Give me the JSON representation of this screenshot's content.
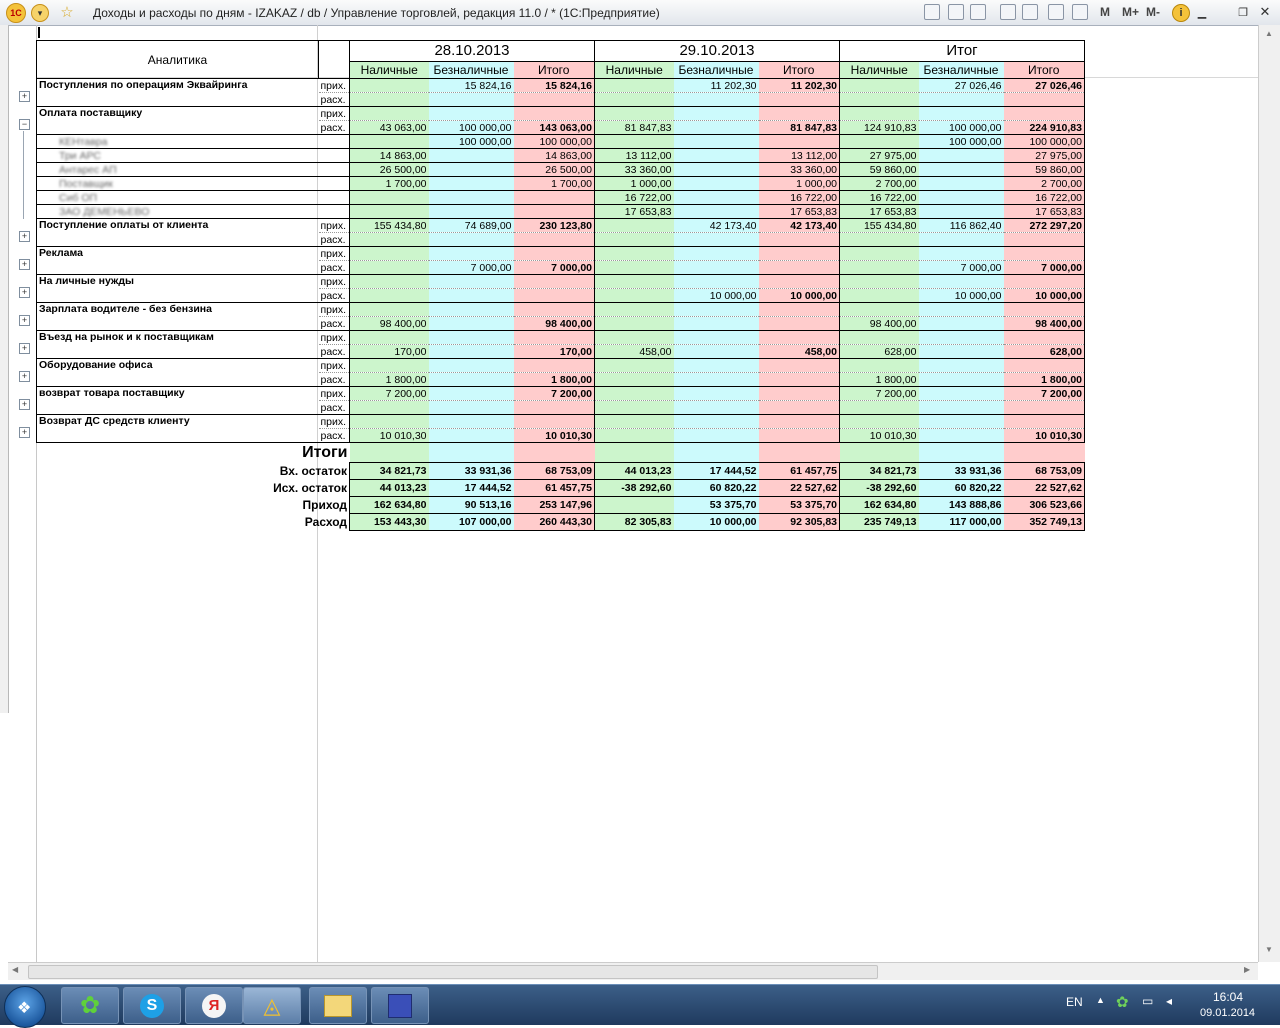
{
  "window": {
    "title": "Доходы и расходы по дням - IZAKAZ / db /  Управление торговлей, редакция 11.0 / * (1С:Предприятие)",
    "toolbar": [
      "M",
      "M+",
      "M-"
    ]
  },
  "report": {
    "analytics_header": "Аналитика",
    "columns": [
      {
        "date": "28.10.2013",
        "sub": [
          "Наличные",
          "Безналичные",
          "Итого"
        ]
      },
      {
        "date": "29.10.2013",
        "sub": [
          "Наличные",
          "Безналичные",
          "Итого"
        ]
      },
      {
        "date": "Итог",
        "sub": [
          "Наличные",
          "Безналичные",
          "Итого"
        ]
      }
    ],
    "prih_label": "прих.",
    "rash_label": "расх.",
    "groups": [
      {
        "name": "Поступления по операциям Эквайринга",
        "expanded": false,
        "prih": [
          "",
          "15 824,16",
          "15 824,16",
          "",
          "11 202,30",
          "11 202,30",
          "",
          "27 026,46",
          "27 026,46"
        ],
        "rash": [
          "",
          "",
          "",
          "",
          "",
          "",
          "",
          "",
          ""
        ]
      },
      {
        "name": "Оплата поставщику",
        "expanded": true,
        "prih": [
          "",
          "",
          "",
          "",
          "",
          "",
          "",
          "",
          ""
        ],
        "rash": [
          "43 063,00",
          "100 000,00",
          "143 063,00",
          "81 847,83",
          "",
          "81 847,83",
          "124 910,83",
          "100 000,00",
          "224 910,83"
        ],
        "children": [
          {
            "name": "КЕНтавра",
            "values": [
              "",
              "100 000,00",
              "100 000,00",
              "",
              "",
              "",
              "",
              "100 000,00",
              "100 000,00"
            ]
          },
          {
            "name": "Три АРС",
            "values": [
              "14 863,00",
              "",
              "14 863,00",
              "13 112,00",
              "",
              "13 112,00",
              "27 975,00",
              "",
              "27 975,00"
            ]
          },
          {
            "name": "Антарес АП",
            "values": [
              "26 500,00",
              "",
              "26 500,00",
              "33 360,00",
              "",
              "33 360,00",
              "59 860,00",
              "",
              "59 860,00"
            ]
          },
          {
            "name": "Поставщик",
            "values": [
              "1 700,00",
              "",
              "1 700,00",
              "1 000,00",
              "",
              "1 000,00",
              "2 700,00",
              "",
              "2 700,00"
            ]
          },
          {
            "name": "Сиб ОП",
            "values": [
              "",
              "",
              "",
              "16 722,00",
              "",
              "16 722,00",
              "16 722,00",
              "",
              "16 722,00"
            ]
          },
          {
            "name": "ЗАО ДЕМЕНЬЕВО",
            "values": [
              "",
              "",
              "",
              "17 653,83",
              "",
              "17 653,83",
              "17 653,83",
              "",
              "17 653,83"
            ]
          }
        ]
      },
      {
        "name": "Поступление оплаты от клиента",
        "expanded": false,
        "prih": [
          "155 434,80",
          "74 689,00",
          "230 123,80",
          "",
          "42 173,40",
          "42 173,40",
          "155 434,80",
          "116 862,40",
          "272 297,20"
        ],
        "rash": [
          "",
          "",
          "",
          "",
          "",
          "",
          "",
          "",
          ""
        ]
      },
      {
        "name": "Реклама",
        "expanded": false,
        "prih": [
          "",
          "",
          "",
          "",
          "",
          "",
          "",
          "",
          ""
        ],
        "rash": [
          "",
          "7 000,00",
          "7 000,00",
          "",
          "",
          "",
          "",
          "7 000,00",
          "7 000,00"
        ]
      },
      {
        "name": "На личные нужды",
        "expanded": false,
        "prih": [
          "",
          "",
          "",
          "",
          "",
          "",
          "",
          "",
          ""
        ],
        "rash": [
          "",
          "",
          "",
          "",
          "10 000,00",
          "10 000,00",
          "",
          "10 000,00",
          "10 000,00"
        ]
      },
      {
        "name": "Зарплата водителе - без бензина",
        "expanded": false,
        "prih": [
          "",
          "",
          "",
          "",
          "",
          "",
          "",
          "",
          ""
        ],
        "rash": [
          "98 400,00",
          "",
          "98 400,00",
          "",
          "",
          "",
          "98 400,00",
          "",
          "98 400,00"
        ]
      },
      {
        "name": "Въезд на рынок и к поставщикам",
        "expanded": false,
        "prih": [
          "",
          "",
          "",
          "",
          "",
          "",
          "",
          "",
          ""
        ],
        "rash": [
          "170,00",
          "",
          "170,00",
          "458,00",
          "",
          "458,00",
          "628,00",
          "",
          "628,00"
        ]
      },
      {
        "name": "Оборудование офиса",
        "expanded": false,
        "prih": [
          "",
          "",
          "",
          "",
          "",
          "",
          "",
          "",
          ""
        ],
        "rash": [
          "1 800,00",
          "",
          "1 800,00",
          "",
          "",
          "",
          "1 800,00",
          "",
          "1 800,00"
        ]
      },
      {
        "name": "возврат товара поставщику",
        "expanded": false,
        "prih": [
          "7 200,00",
          "",
          "7 200,00",
          "",
          "",
          "",
          "7 200,00",
          "",
          "7 200,00"
        ],
        "rash": [
          "",
          "",
          "",
          "",
          "",
          "",
          "",
          "",
          ""
        ]
      },
      {
        "name": "Возврат ДС средств клиенту",
        "expanded": false,
        "prih": [
          "",
          "",
          "",
          "",
          "",
          "",
          "",
          "",
          ""
        ],
        "rash": [
          "10 010,30",
          "",
          "10 010,30",
          "",
          "",
          "",
          "10 010,30",
          "",
          "10 010,30"
        ]
      }
    ],
    "totals": {
      "title": "Итоги",
      "rows": [
        {
          "label": "Вх. остаток",
          "values": [
            "34 821,73",
            "33 931,36",
            "68 753,09",
            "44 013,23",
            "17 444,52",
            "61 457,75",
            "34 821,73",
            "33 931,36",
            "68 753,09"
          ]
        },
        {
          "label": "Исх. остаток",
          "values": [
            "44 013,23",
            "17 444,52",
            "61 457,75",
            "-38 292,60",
            "60 820,22",
            "22 527,62",
            "-38 292,60",
            "60 820,22",
            "22 527,62"
          ]
        },
        {
          "label": "Приход",
          "values": [
            "162 634,80",
            "90 513,16",
            "253 147,96",
            "",
            "53 375,70",
            "53 375,70",
            "162 634,80",
            "143 888,86",
            "306 523,66"
          ]
        },
        {
          "label": "Расход",
          "values": [
            "153 443,30",
            "107 000,00",
            "260 443,30",
            "82 305,83",
            "10 000,00",
            "92 305,83",
            "235 749,13",
            "117 000,00",
            "352 749,13"
          ]
        }
      ]
    }
  },
  "taskbar": {
    "apps": [
      "start",
      "icq",
      "skype",
      "yandex",
      "1c",
      "explorer",
      "save"
    ],
    "lang": "EN",
    "time": "16:04",
    "date": "09.01.2014"
  },
  "colors": {
    "cash": "#ccf5cc",
    "noncash": "#ccfafc",
    "total": "#ffcccc"
  }
}
